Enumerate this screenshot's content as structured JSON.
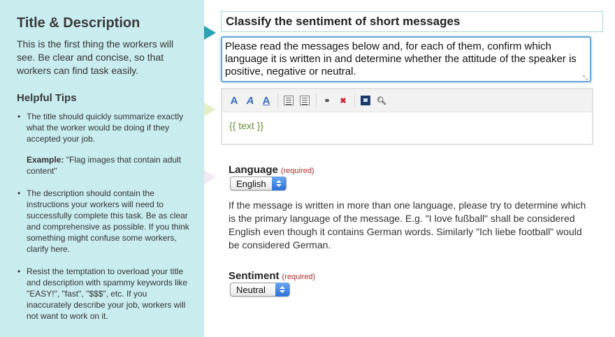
{
  "sidebar": {
    "title": "Title & Description",
    "intro": "This is the first thing the workers will see. Be clear and concise, so that workers can find task easily.",
    "tips_title": "Helpful Tips",
    "tips": [
      {
        "text": "The title should quickly summarize exactly what the worker would be doing if they accepted your job.",
        "example_label": "Example:",
        "example_text": "\"Flag images that contain adult content\""
      },
      {
        "text": "The description should contain the instructions your workers will need to successfully complete this task. Be as clear and comprehensive as possible. If you think something might confuse some workers, clarify here."
      },
      {
        "text": "Resist the temptation to overload your title and description with spammy keywords like \"EASY!\", \"fast\", \"$$$\", etc. If you inaccurately describe your job, workers will not want to work on it."
      }
    ]
  },
  "form": {
    "title_value": "Classify the sentiment of short messages",
    "description_value": "Please read the messages below and, for each of them, confirm which language it is written in and determine whether the attitude of the speaker is positive, negative or neutral.",
    "editor": {
      "toolbar_icons": [
        "font-size-icon",
        "italic-font-icon",
        "underline-font-icon",
        "unordered-list-icon",
        "ordered-list-icon",
        "link-icon",
        "unlink-icon",
        "image-icon",
        "preview-icon"
      ],
      "content": "{{ text }}"
    },
    "language": {
      "label": "Language",
      "required": "(required)",
      "selected": "English",
      "help": "If the message is written in more than one language, please try to determine which is the primary language of the message. E.g. \"I love fußball\" shall be considered English even though it contains German words. Similarly \"Ich liebe football\" would be considered German."
    },
    "sentiment": {
      "label": "Sentiment",
      "required": "(required)",
      "selected": "Neutral"
    }
  },
  "colors": {
    "sidebar_bg": "#c9ecef",
    "pointer_active": "#2aa4b3",
    "focus_border": "#6aa6d9",
    "required_text": "#b03030",
    "liquid_tag": "#6a8f3a"
  }
}
